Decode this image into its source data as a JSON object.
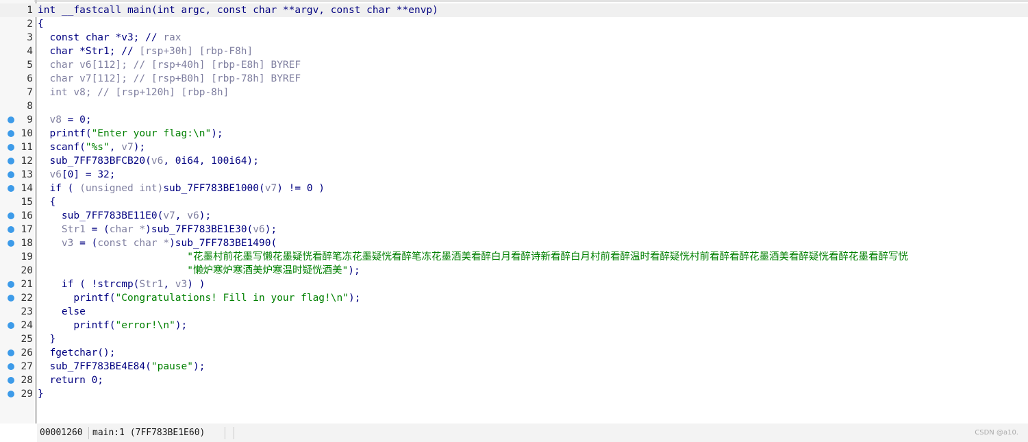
{
  "code_lines": [
    {
      "n": "1",
      "bp": false,
      "cur": true,
      "seg": [
        {
          "t": "int __fastcall main(int argc, const char **argv, const char **envp)",
          "c": "k"
        }
      ]
    },
    {
      "n": "2",
      "bp": false,
      "seg": [
        {
          "t": "{",
          "c": "k"
        }
      ]
    },
    {
      "n": "3",
      "bp": false,
      "seg": [
        {
          "t": "  const char *v3; // ",
          "c": "k"
        },
        {
          "t": "rax",
          "c": "v"
        }
      ]
    },
    {
      "n": "4",
      "bp": false,
      "seg": [
        {
          "t": "  char *Str1; // ",
          "c": "k"
        },
        {
          "t": "[rsp+30h] [rbp-F8h]",
          "c": "v"
        }
      ]
    },
    {
      "n": "5",
      "bp": false,
      "seg": [
        {
          "t": "  char v6[112]; // ",
          "c": "v"
        },
        {
          "t": "[rsp+40h] [rbp-E8h] BYREF",
          "c": "v"
        }
      ]
    },
    {
      "n": "6",
      "bp": false,
      "seg": [
        {
          "t": "  char v7[112]; // ",
          "c": "v"
        },
        {
          "t": "[rsp+B0h] [rbp-78h] BYREF",
          "c": "v"
        }
      ]
    },
    {
      "n": "7",
      "bp": false,
      "seg": [
        {
          "t": "  int v8; // ",
          "c": "v"
        },
        {
          "t": "[rsp+120h] [rbp-8h]",
          "c": "v"
        }
      ]
    },
    {
      "n": "8",
      "bp": false,
      "seg": [
        {
          "t": "",
          "c": "k"
        }
      ]
    },
    {
      "n": "9",
      "bp": true,
      "seg": [
        {
          "t": "  ",
          "c": "k"
        },
        {
          "t": "v8",
          "c": "v"
        },
        {
          "t": " = 0;",
          "c": "k"
        }
      ]
    },
    {
      "n": "10",
      "bp": true,
      "seg": [
        {
          "t": "  printf(",
          "c": "k"
        },
        {
          "t": "\"Enter your flag:\\n\"",
          "c": "s"
        },
        {
          "t": ");",
          "c": "k"
        }
      ]
    },
    {
      "n": "11",
      "bp": true,
      "seg": [
        {
          "t": "  scanf(",
          "c": "k"
        },
        {
          "t": "\"%s\"",
          "c": "s"
        },
        {
          "t": ", ",
          "c": "k"
        },
        {
          "t": "v7",
          "c": "v"
        },
        {
          "t": ");",
          "c": "k"
        }
      ]
    },
    {
      "n": "12",
      "bp": true,
      "seg": [
        {
          "t": "  sub_7FF783BFCB20(",
          "c": "k"
        },
        {
          "t": "v6",
          "c": "v"
        },
        {
          "t": ", 0i64, 100i64);",
          "c": "k"
        }
      ]
    },
    {
      "n": "13",
      "bp": true,
      "seg": [
        {
          "t": "  ",
          "c": "k"
        },
        {
          "t": "v6",
          "c": "v"
        },
        {
          "t": "[0] = 32;",
          "c": "k"
        }
      ]
    },
    {
      "n": "14",
      "bp": true,
      "seg": [
        {
          "t": "  if ( ",
          "c": "k"
        },
        {
          "t": "(unsigned int)",
          "c": "v"
        },
        {
          "t": "sub_7FF783BE1000(",
          "c": "k"
        },
        {
          "t": "v7",
          "c": "v"
        },
        {
          "t": ") != 0 )",
          "c": "k"
        }
      ]
    },
    {
      "n": "15",
      "bp": false,
      "seg": [
        {
          "t": "  {",
          "c": "k"
        }
      ]
    },
    {
      "n": "16",
      "bp": true,
      "seg": [
        {
          "t": "    sub_7FF783BE11E0(",
          "c": "k"
        },
        {
          "t": "v7",
          "c": "v"
        },
        {
          "t": ", ",
          "c": "k"
        },
        {
          "t": "v6",
          "c": "v"
        },
        {
          "t": ");",
          "c": "k"
        }
      ]
    },
    {
      "n": "17",
      "bp": true,
      "seg": [
        {
          "t": "    Str1",
          "c": "v"
        },
        {
          "t": " = (",
          "c": "k"
        },
        {
          "t": "char *",
          "c": "v"
        },
        {
          "t": ")sub_7FF783BE1E30(",
          "c": "k"
        },
        {
          "t": "v6",
          "c": "v"
        },
        {
          "t": ");",
          "c": "k"
        }
      ]
    },
    {
      "n": "18",
      "bp": true,
      "seg": [
        {
          "t": "    v3",
          "c": "v"
        },
        {
          "t": " = (",
          "c": "k"
        },
        {
          "t": "const char *",
          "c": "v"
        },
        {
          "t": ")sub_7FF783BE1490(",
          "c": "k"
        }
      ]
    },
    {
      "n": "19",
      "bp": false,
      "seg": [
        {
          "t": "                         ",
          "c": "k"
        },
        {
          "t": "\"花墨村前花墨写懒花墨疑恍看醉笔冻花墨疑恍看醉笔冻花墨酒美看醉白月看醉诗新看醉白月村前看醉温时看醉疑恍村前看醉看醉花墨酒美看醉疑恍看醉花墨看醉写恍",
          "c": "s"
        }
      ]
    },
    {
      "n": "20",
      "bp": false,
      "seg": [
        {
          "t": "                         ",
          "c": "k"
        },
        {
          "t": "\"懒炉寒炉寒酒美炉寒温时疑恍酒美\"",
          "c": "s"
        },
        {
          "t": ");",
          "c": "k"
        }
      ]
    },
    {
      "n": "21",
      "bp": true,
      "seg": [
        {
          "t": "    if ( !strcmp(",
          "c": "k"
        },
        {
          "t": "Str1",
          "c": "v"
        },
        {
          "t": ", ",
          "c": "k"
        },
        {
          "t": "v3",
          "c": "v"
        },
        {
          "t": ") )",
          "c": "k"
        }
      ]
    },
    {
      "n": "22",
      "bp": true,
      "seg": [
        {
          "t": "      printf(",
          "c": "k"
        },
        {
          "t": "\"Congratulations! Fill in your flag!\\n\"",
          "c": "s"
        },
        {
          "t": ");",
          "c": "k"
        }
      ]
    },
    {
      "n": "23",
      "bp": false,
      "seg": [
        {
          "t": "    else",
          "c": "k"
        }
      ]
    },
    {
      "n": "24",
      "bp": true,
      "seg": [
        {
          "t": "      printf(",
          "c": "k"
        },
        {
          "t": "\"error!\\n\"",
          "c": "s"
        },
        {
          "t": ");",
          "c": "k"
        }
      ]
    },
    {
      "n": "25",
      "bp": false,
      "seg": [
        {
          "t": "  }",
          "c": "k"
        }
      ]
    },
    {
      "n": "26",
      "bp": true,
      "seg": [
        {
          "t": "  fgetchar();",
          "c": "k"
        }
      ]
    },
    {
      "n": "27",
      "bp": true,
      "seg": [
        {
          "t": "  sub_7FF783BE4E84(",
          "c": "k"
        },
        {
          "t": "\"pause\"",
          "c": "s"
        },
        {
          "t": ");",
          "c": "k"
        }
      ]
    },
    {
      "n": "28",
      "bp": true,
      "seg": [
        {
          "t": "  return 0;",
          "c": "k"
        }
      ]
    },
    {
      "n": "29",
      "bp": true,
      "seg": [
        {
          "t": "}",
          "c": "k"
        }
      ]
    }
  ],
  "statusbar": {
    "address": "00001260",
    "location": "main:1 (7FF783BE1E60)",
    "watermark": "CSDN @a10."
  },
  "colors": {
    "keyword": "#000080",
    "variable": "#7f7fa0",
    "string": "#008000",
    "breakpoint": "#3d9be9"
  }
}
